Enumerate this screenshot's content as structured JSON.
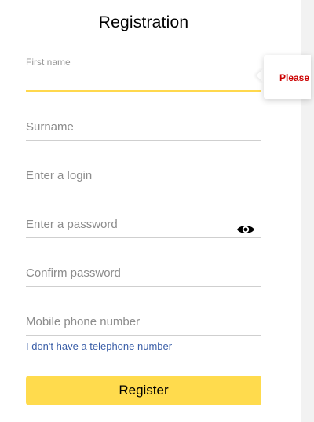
{
  "title": "Registration",
  "fields": {
    "first_name": {
      "label": "First name",
      "value": ""
    },
    "surname": {
      "placeholder": "Surname",
      "value": ""
    },
    "login": {
      "placeholder": "Enter a login",
      "value": ""
    },
    "password": {
      "placeholder": "Enter a password",
      "value": "",
      "toggle_icon": "eye-icon"
    },
    "confirm_password": {
      "placeholder": "Confirm password",
      "value": ""
    },
    "phone": {
      "placeholder": "Mobile phone number",
      "value": ""
    }
  },
  "no_phone_link": "I don't have a telephone number",
  "register_button": "Register",
  "tooltip": {
    "text": "Please e"
  },
  "colors": {
    "accent": "#ffdb4d",
    "link": "#3b5fa8",
    "error": "#cc0000"
  }
}
